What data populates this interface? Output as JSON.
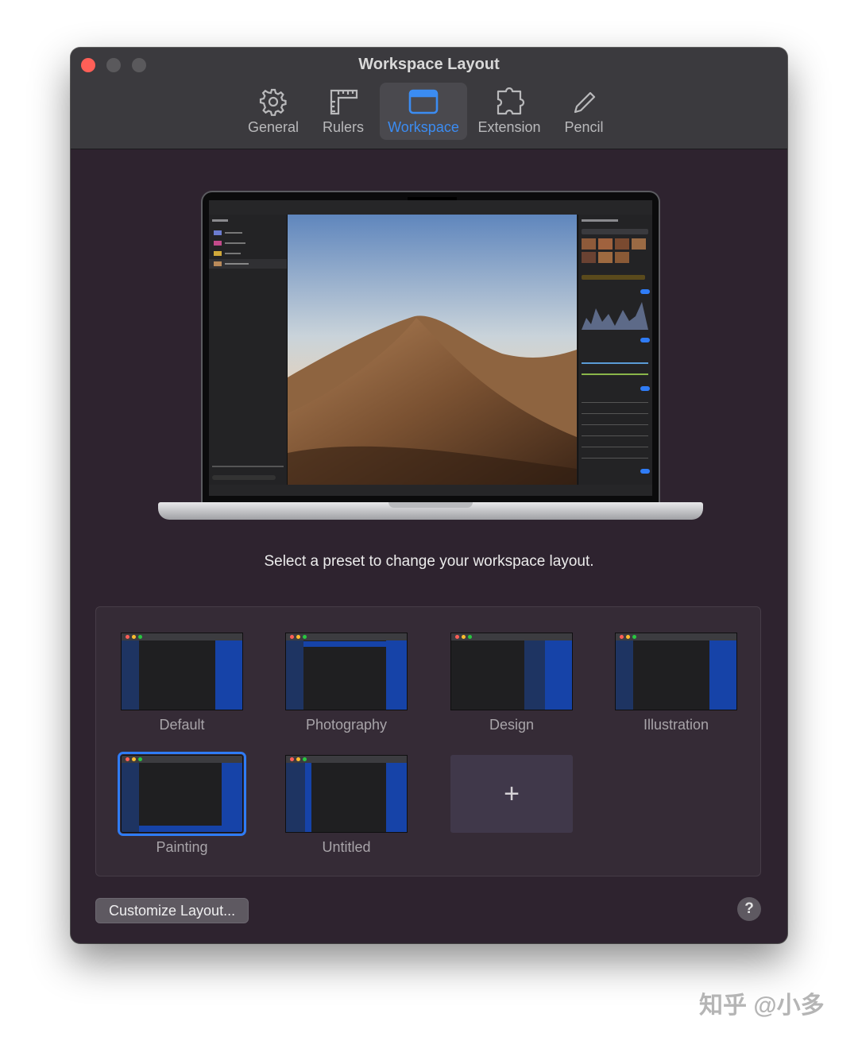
{
  "window": {
    "title": "Workspace Layout"
  },
  "tabs": [
    {
      "label": "General",
      "icon": "gear-icon"
    },
    {
      "label": "Rulers",
      "icon": "ruler-icon"
    },
    {
      "label": "Workspace",
      "icon": "window-icon",
      "active": true
    },
    {
      "label": "Extension",
      "icon": "puzzle-icon"
    },
    {
      "label": "Pencil",
      "icon": "pencil-icon"
    }
  ],
  "instruction": "Select a preset to change your workspace layout.",
  "presets": [
    {
      "label": "Default"
    },
    {
      "label": "Photography"
    },
    {
      "label": "Design"
    },
    {
      "label": "Illustration"
    },
    {
      "label": "Painting",
      "selected": true
    },
    {
      "label": "Untitled"
    }
  ],
  "add_preset_symbol": "+",
  "footer": {
    "customize_label": "Customize Layout...",
    "help_label": "?"
  },
  "watermark": "知乎 @小多",
  "colors": {
    "accent": "#2f7cf6",
    "close": "#ff5f57",
    "panel_blue": "#1643a8",
    "window_bg": "#2e232f"
  }
}
